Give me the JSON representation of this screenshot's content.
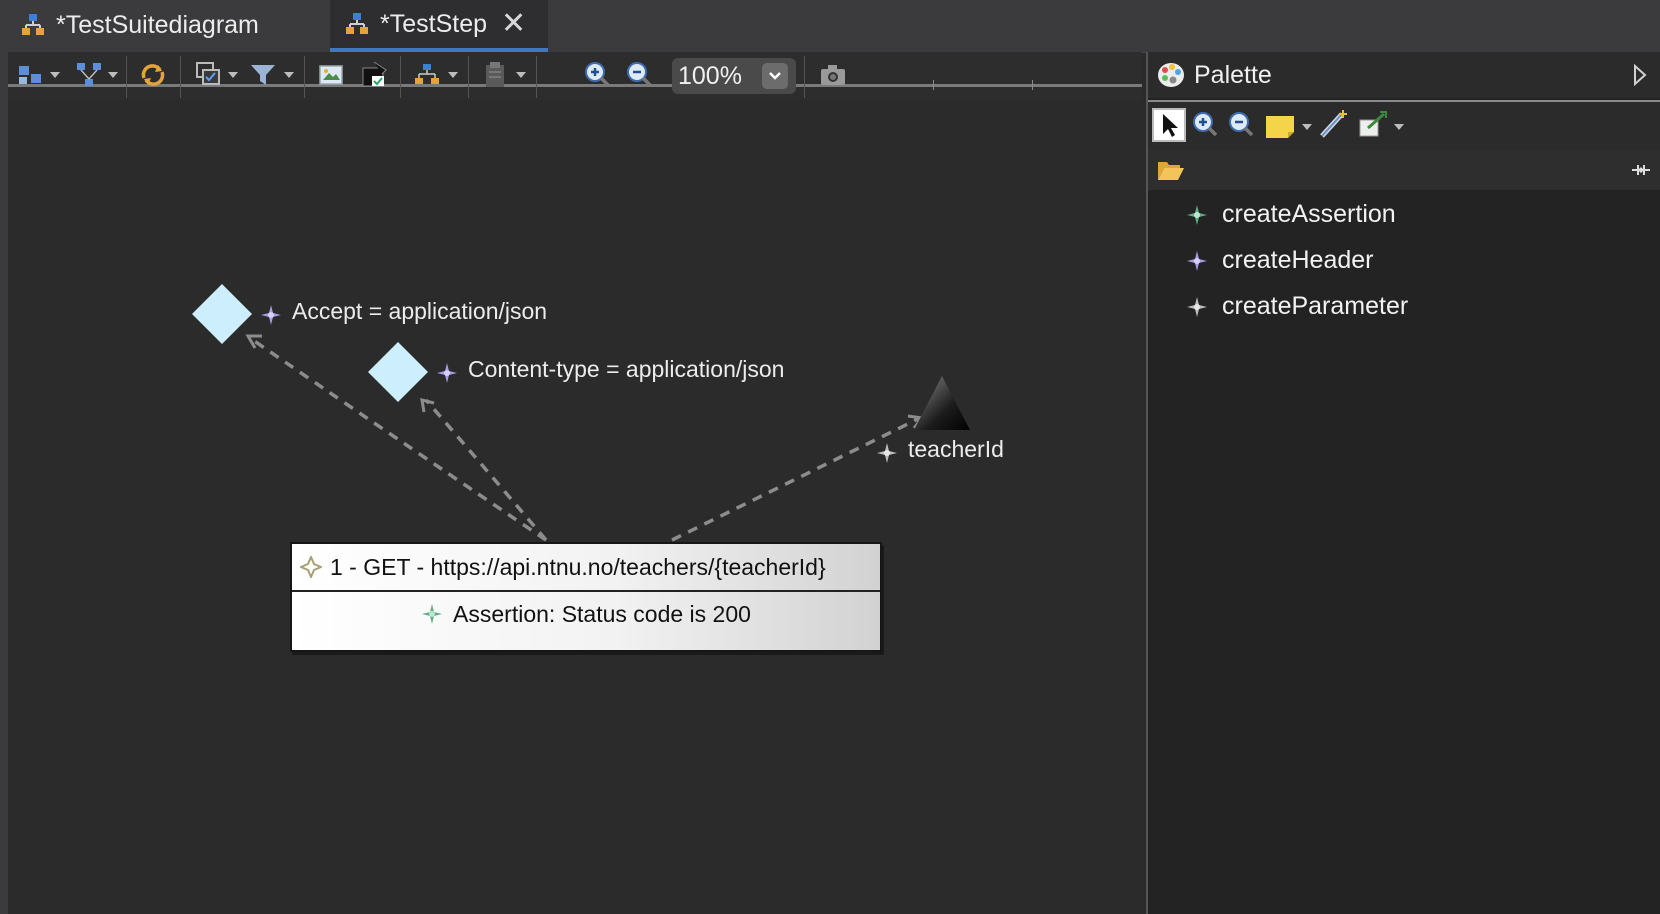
{
  "tabs": [
    {
      "label": "*TestSuitediagram",
      "active": false
    },
    {
      "label": "*TestStep",
      "active": true
    }
  ],
  "toolbar": {
    "zoom_value": "100%"
  },
  "diagram": {
    "header_nodes": [
      {
        "label": "Accept = application/json"
      },
      {
        "label": "Content-type = application/json"
      }
    ],
    "parameter_node": {
      "label": "teacherId"
    },
    "request": {
      "title": "1 - GET - https://api.ntnu.no/teachers/{teacherId}",
      "assertion": "Assertion: Status code is 200"
    }
  },
  "palette": {
    "title": "Palette",
    "entries": [
      {
        "label": "createAssertion",
        "icon": "assertion-icon",
        "color": "#5fae86"
      },
      {
        "label": "createHeader",
        "icon": "header-icon",
        "color": "#a79be6"
      },
      {
        "label": "createParameter",
        "icon": "parameter-icon",
        "color": "#bdbdbd"
      }
    ]
  },
  "colors": {
    "node_diamond": "#cdeefc",
    "active_tab_accent": "#3f78c4",
    "connection": "#8c8c8c"
  }
}
